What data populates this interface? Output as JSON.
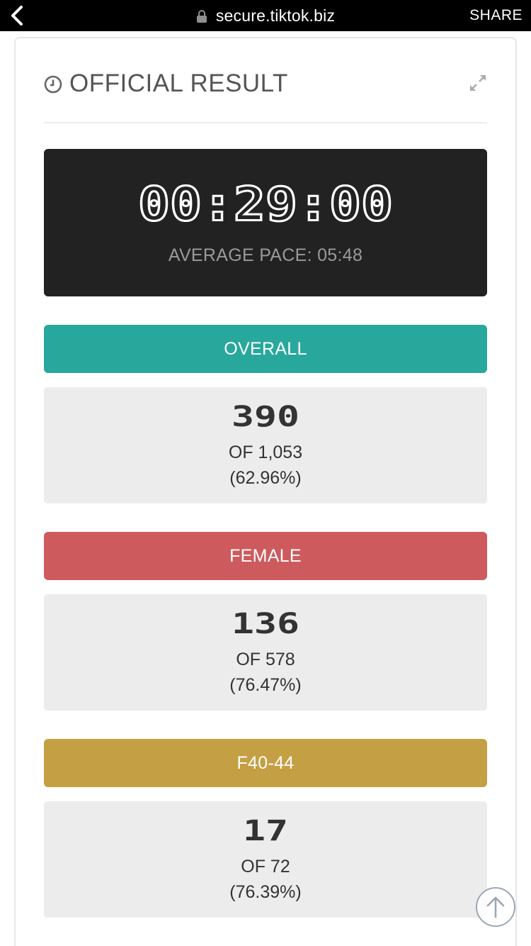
{
  "browser": {
    "url": "secure.tiktok.biz",
    "share_label": "SHARE"
  },
  "result": {
    "title": "OFFICIAL RESULT",
    "time": "00:29:00",
    "pace_line": "AVERAGE PACE: 05:48"
  },
  "rankings": [
    {
      "label": "OVERALL",
      "rank": "390",
      "of": "OF 1,053",
      "pct": "(62.96%)",
      "color": "#28a89c"
    },
    {
      "label": "FEMALE",
      "rank": "136",
      "of": "OF 578",
      "pct": "(76.47%)",
      "color": "#cd5b5e"
    },
    {
      "label": "F40-44",
      "rank": "17",
      "of": "OF 72",
      "pct": "(76.39%)",
      "color": "#c49f44"
    }
  ],
  "icons": {
    "back": "chevron-left-icon",
    "lock": "lock-icon",
    "clock": "clock-icon",
    "expand": "expand-icon",
    "scroll_top": "arrow-up-circle-icon"
  }
}
